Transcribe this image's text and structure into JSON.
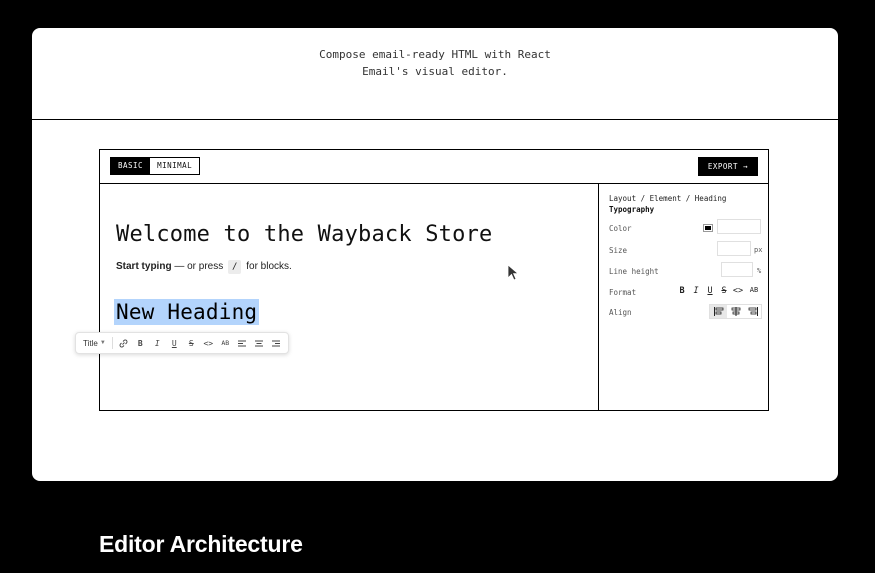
{
  "intro": {
    "line1": "Compose email-ready HTML with React",
    "line2": "Email's visual editor."
  },
  "editor": {
    "modes": [
      "BASIC",
      "MINIMAL"
    ],
    "active_mode": "BASIC",
    "export_label": "EXPORT →",
    "heading": "Welcome to the Wayback Store",
    "hint_bold": "Start typing",
    "hint_mid": " — or press ",
    "hint_key": "/",
    "hint_end": " for blocks.",
    "selected_heading": "New Heading"
  },
  "toolbar": {
    "block_type": "Title",
    "buttons": [
      "link-icon",
      "bold",
      "italic",
      "underline",
      "strikethrough",
      "code",
      "uppercase",
      "align-left",
      "align-center",
      "align-right"
    ],
    "labels": {
      "bold": "B",
      "italic": "I",
      "underline": "U",
      "strike": "S",
      "code": "<>",
      "caps": "AB"
    }
  },
  "panel": {
    "breadcrumb": "Layout / Element / Heading",
    "section": "Typography",
    "color_label": "Color",
    "color_value": "#000000",
    "size_label": "Size",
    "size_unit": "px",
    "line_height_label": "Line height",
    "line_height_unit": "%",
    "format_label": "Format",
    "align_label": "Align",
    "format": {
      "bold": "B",
      "italic": "I",
      "underline": "U",
      "strike": "S",
      "code": "<>",
      "caps": "AB"
    },
    "active_align": "left"
  },
  "section_heading": "Editor Architecture"
}
